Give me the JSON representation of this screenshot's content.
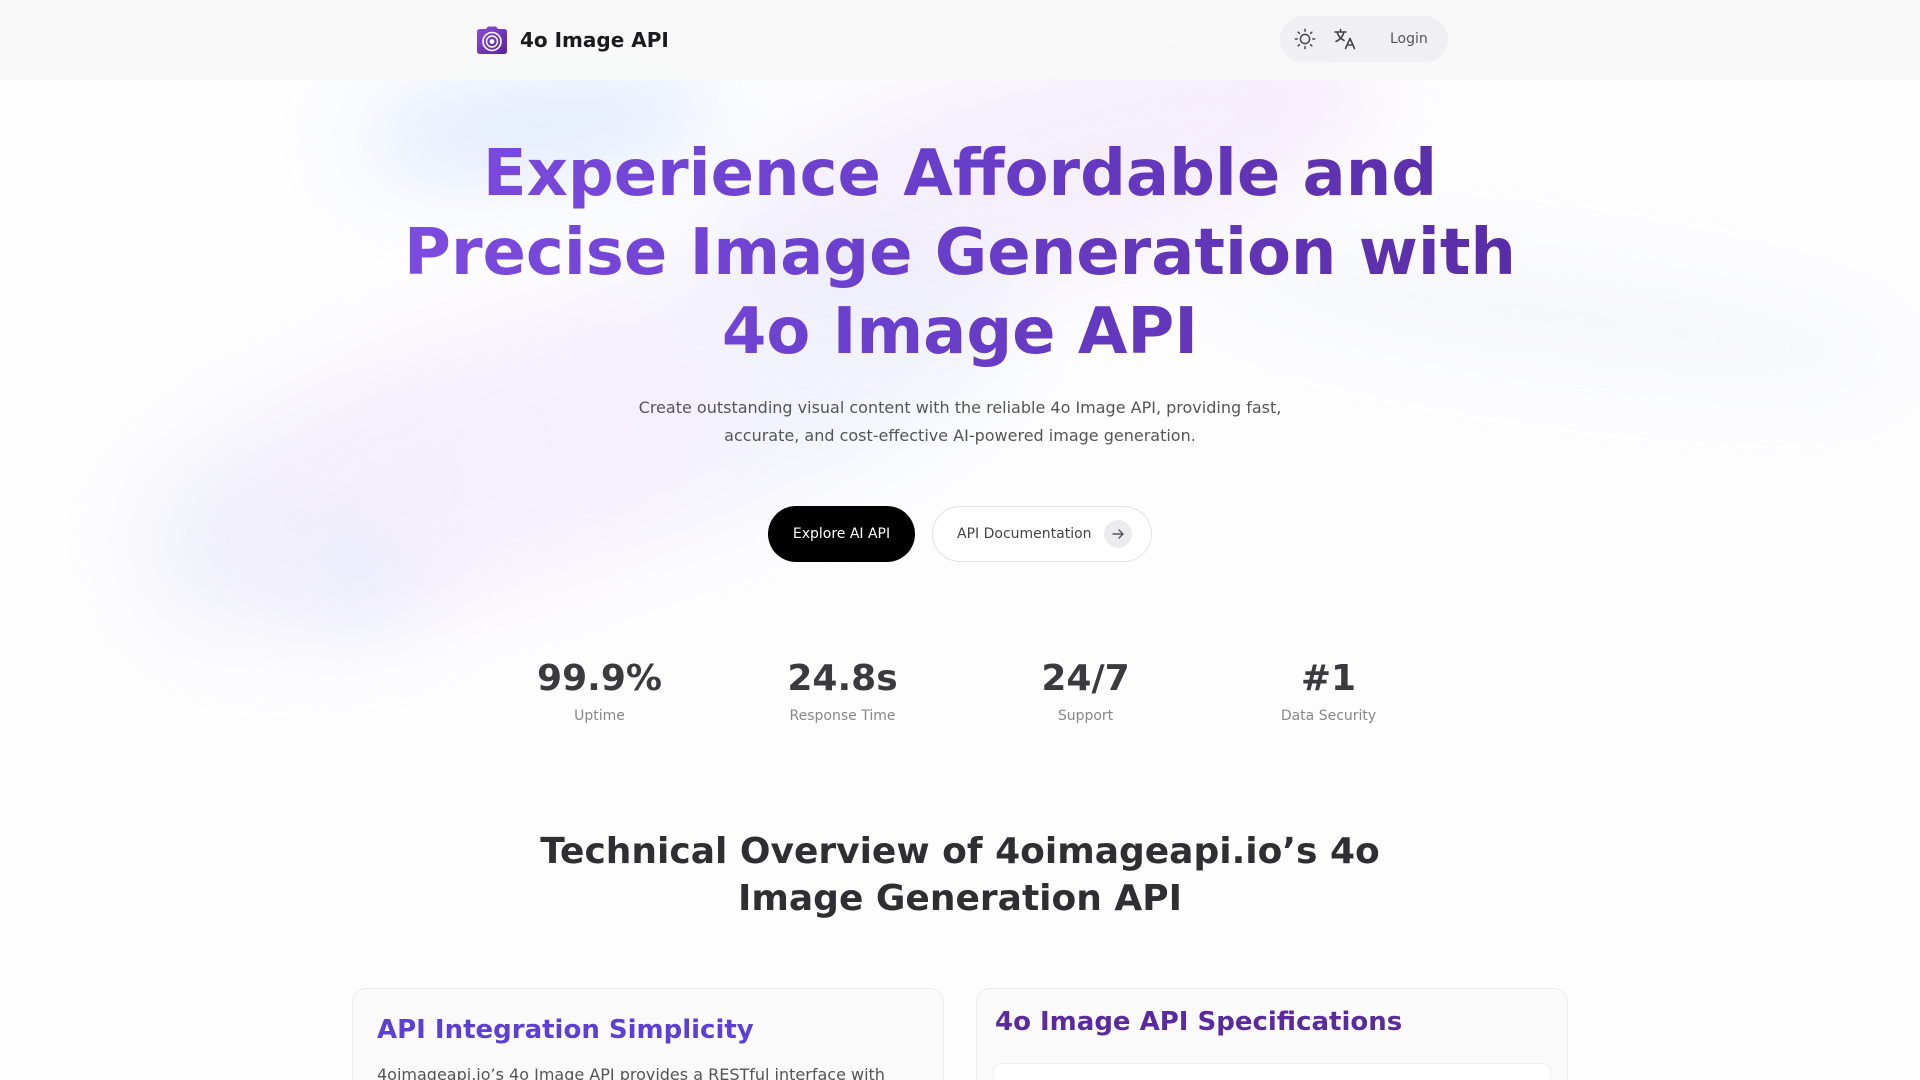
{
  "header": {
    "brand_name": "4o Image API",
    "theme_icon": "sun-icon",
    "language_icon": "translate-icon",
    "login_label": "Login"
  },
  "hero": {
    "title_line1": "Experience Affordable and",
    "title_line2": "Precise Image Generation with",
    "title_line3": "4o Image API",
    "subtitle_line1": "Create outstanding visual content with the reliable 4o Image API, providing fast,",
    "subtitle_line2": "accurate, and cost-effective AI-powered image generation.",
    "primary_cta": "Explore AI API",
    "secondary_cta": "API Documentation"
  },
  "stats": [
    {
      "value": "99.9%",
      "label": "Uptime"
    },
    {
      "value": "24.8s",
      "label": "Response Time"
    },
    {
      "value": "24/7",
      "label": "Support"
    },
    {
      "value": "#1",
      "label": "Data Security"
    }
  ],
  "overview": {
    "title_line1": "Technical Overview of 4oimageapi.io’s 4o",
    "title_line2": "Image Generation API",
    "card_left_title": "API Integration Simplicity",
    "card_left_text": "4oimageapi.io’s 4o Image API provides a RESTful interface with",
    "card_right_title": "4o Image API Specifications"
  },
  "colors": {
    "accent_purple": "#6a3fcb",
    "primary_button": "#000000"
  }
}
